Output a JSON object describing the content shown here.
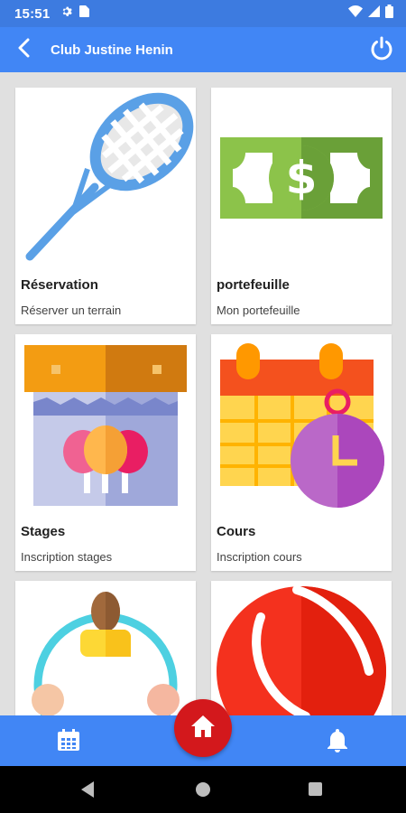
{
  "status_bar": {
    "time": "15:51"
  },
  "app_bar": {
    "title": "Club Justine Henin"
  },
  "cards": [
    {
      "title": "Réservation",
      "subtitle": "Réserver un terrain",
      "icon": "tennis-racket-icon"
    },
    {
      "title": "portefeuille",
      "subtitle": "Mon portefeuille",
      "icon": "banknote-icon"
    },
    {
      "title": "Stages",
      "subtitle": "Inscription stages",
      "icon": "market-stall-icon"
    },
    {
      "title": "Cours",
      "subtitle": "Inscription cours",
      "icon": "calendar-clock-icon"
    },
    {
      "title": "",
      "subtitle": "",
      "icon": "group-icon"
    },
    {
      "title": "",
      "subtitle": "",
      "icon": "tennis-ball-icon"
    }
  ],
  "bottom_nav": {
    "left_icon": "calendar-icon",
    "center_icon": "home-icon",
    "right_icon": "bell-icon"
  },
  "colors": {
    "primary": "#4186f5",
    "status_bar": "#3d7be0",
    "accent": "#d3181c",
    "background": "#e0e0e0"
  }
}
